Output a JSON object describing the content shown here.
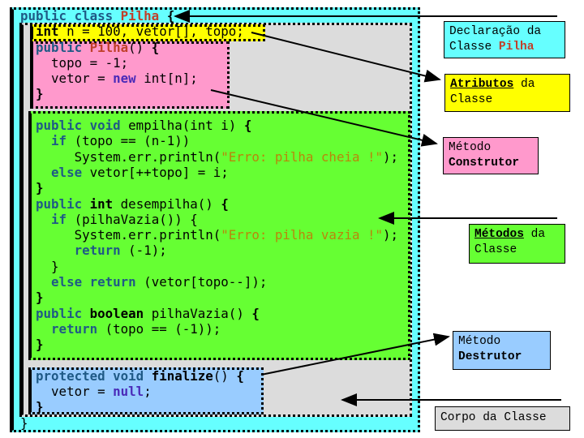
{
  "code_lines": [
    [
      {
        "t": "public class ",
        "k": "kw"
      },
      {
        "t": "Pilha",
        "k": "cls"
      },
      {
        "t": " {",
        "k": "br"
      }
    ],
    [
      {
        "t": "  "
      },
      {
        "t": "int",
        "k": "ty"
      },
      {
        "t": " n = 100, vetor[], topo;"
      }
    ],
    [
      {
        "t": "  "
      },
      {
        "t": "public ",
        "k": "kw"
      },
      {
        "t": "Pilha",
        "k": "cls"
      },
      {
        "t": "() "
      },
      {
        "t": "{",
        "k": "br"
      }
    ],
    [
      {
        "t": "    topo = -1;"
      }
    ],
    [
      {
        "t": "    vetor = "
      },
      {
        "t": "new",
        "k": "nw"
      },
      {
        "t": " int[n];"
      }
    ],
    [
      {
        "t": "  "
      },
      {
        "t": "}",
        "k": "br"
      }
    ],
    [
      {
        "t": ""
      }
    ],
    [
      {
        "t": "  "
      },
      {
        "t": "public void",
        "k": "kw"
      },
      {
        "t": " empilha(int i) "
      },
      {
        "t": "{",
        "k": "br"
      }
    ],
    [
      {
        "t": "    "
      },
      {
        "t": "if",
        "k": "kw"
      },
      {
        "t": " (topo == (n-1))"
      }
    ],
    [
      {
        "t": "       System.err.println("
      },
      {
        "t": "\"Erro: pilha cheia !\"",
        "k": "str"
      },
      {
        "t": ");"
      }
    ],
    [
      {
        "t": "    "
      },
      {
        "t": "else",
        "k": "kw"
      },
      {
        "t": " vetor[++topo] = i;"
      }
    ],
    [
      {
        "t": "  "
      },
      {
        "t": "}",
        "k": "br"
      }
    ],
    [
      {
        "t": "  "
      },
      {
        "t": "public ",
        "k": "kw"
      },
      {
        "t": "int",
        "k": "ty"
      },
      {
        "t": " desempilha() "
      },
      {
        "t": "{",
        "k": "br"
      }
    ],
    [
      {
        "t": "    "
      },
      {
        "t": "if",
        "k": "kw"
      },
      {
        "t": " (pilhaVazia()) {"
      }
    ],
    [
      {
        "t": "       System.err.println("
      },
      {
        "t": "\"Erro: pilha vazia !\"",
        "k": "str"
      },
      {
        "t": ");"
      }
    ],
    [
      {
        "t": "       "
      },
      {
        "t": "return",
        "k": "kw"
      },
      {
        "t": " (-1);"
      }
    ],
    [
      {
        "t": "    }"
      }
    ],
    [
      {
        "t": "    "
      },
      {
        "t": "else return",
        "k": "kw"
      },
      {
        "t": " (vetor[topo--]);"
      }
    ],
    [
      {
        "t": "  "
      },
      {
        "t": "}",
        "k": "br"
      }
    ],
    [
      {
        "t": "  "
      },
      {
        "t": "public ",
        "k": "kw"
      },
      {
        "t": "boolean",
        "k": "ty"
      },
      {
        "t": " pilhaVazia() "
      },
      {
        "t": "{",
        "k": "br"
      }
    ],
    [
      {
        "t": "    "
      },
      {
        "t": "return",
        "k": "kw"
      },
      {
        "t": " (topo == (-1));"
      }
    ],
    [
      {
        "t": "  "
      },
      {
        "t": "}",
        "k": "br"
      }
    ],
    [
      {
        "t": ""
      }
    ],
    [
      {
        "t": "  "
      },
      {
        "t": "protected void",
        "k": "kw"
      },
      {
        "t": " "
      },
      {
        "t": "finalize",
        "k": "ty"
      },
      {
        "t": "() "
      },
      {
        "t": "{",
        "k": "br"
      }
    ],
    [
      {
        "t": "    vetor = "
      },
      {
        "t": "null",
        "k": "nw"
      },
      {
        "t": ";"
      }
    ],
    [
      {
        "t": "  "
      },
      {
        "t": "}",
        "k": "br"
      }
    ],
    [
      {
        "t": "}"
      }
    ]
  ],
  "labels": {
    "declaracao": {
      "line1": "Declaração da",
      "line2a": "Classe ",
      "line2b": "Pilha"
    },
    "atributos": {
      "bold": "Atributos",
      "rest": " da",
      "line2": "Classe"
    },
    "construtor": {
      "line1": "Método",
      "line2": "Construtor"
    },
    "metodos": {
      "bold": "Métodos",
      "rest": " da",
      "line2": "Classe"
    },
    "destrutor": {
      "line1": "Método",
      "line2": "Destrutor"
    },
    "corpo": {
      "text": "Corpo da Classe"
    }
  },
  "colors": {
    "class_declaration": "#66ffff",
    "attributes": "#ffff00",
    "constructor": "#ff99cc",
    "methods": "#66ff33",
    "destructor": "#99ccff",
    "class_body": "#dcdcdc"
  }
}
